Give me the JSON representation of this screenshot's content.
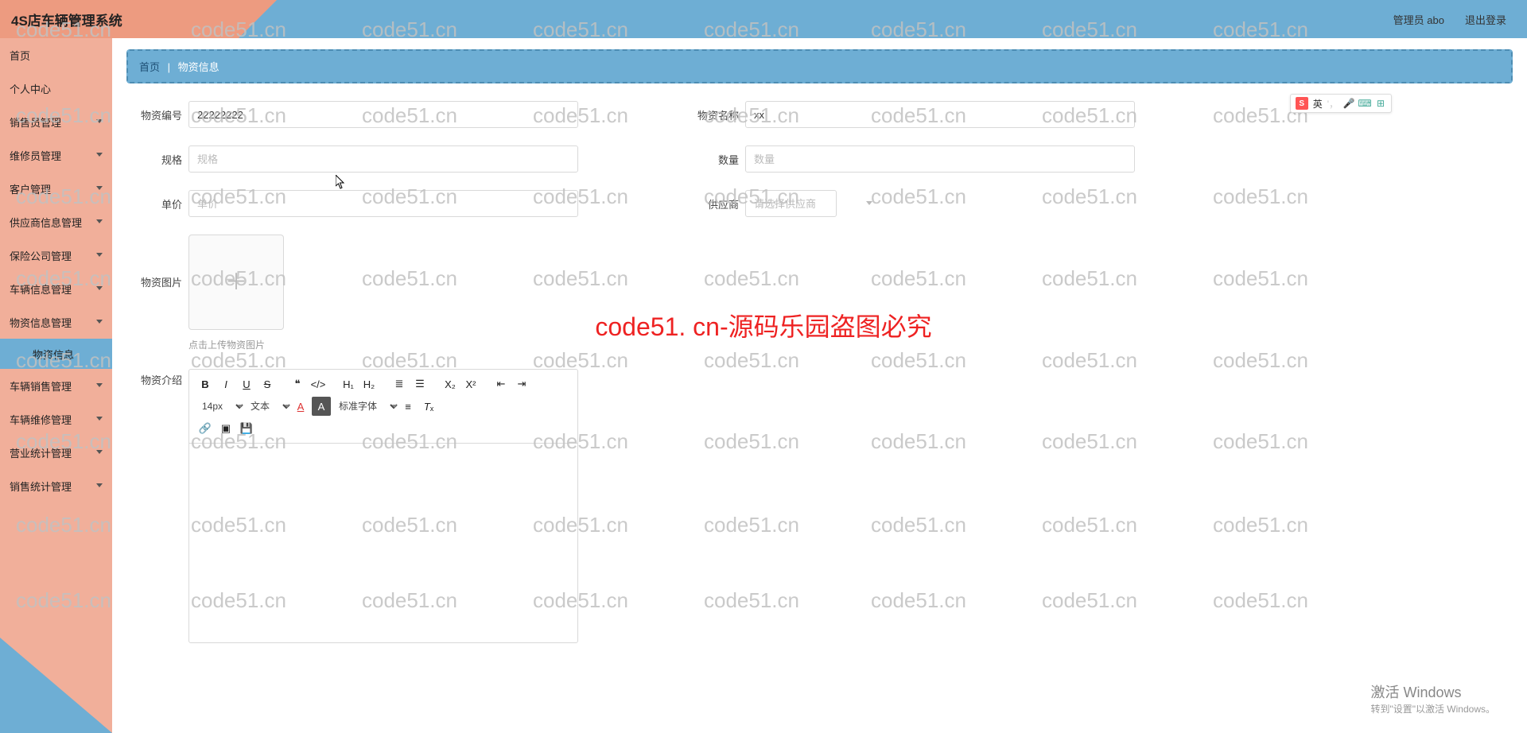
{
  "header": {
    "title": "4S店车辆管理系统",
    "user_label": "管理员 abo",
    "logout": "退出登录"
  },
  "sidebar": {
    "items": [
      {
        "label": "首页",
        "sub": false
      },
      {
        "label": "个人中心",
        "sub": false
      },
      {
        "label": "销售员管理",
        "sub": true
      },
      {
        "label": "维修员管理",
        "sub": true
      },
      {
        "label": "客户管理",
        "sub": true
      },
      {
        "label": "供应商信息管理",
        "sub": true
      },
      {
        "label": "保险公司管理",
        "sub": true
      },
      {
        "label": "车辆信息管理",
        "sub": true
      },
      {
        "label": "物资信息管理",
        "sub": true,
        "open": true,
        "child": "物资信息"
      },
      {
        "label": "车辆销售管理",
        "sub": true
      },
      {
        "label": "车辆维修管理",
        "sub": true
      },
      {
        "label": "营业统计管理",
        "sub": true
      },
      {
        "label": "销售统计管理",
        "sub": true
      }
    ]
  },
  "breadcrumb": {
    "home": "首页",
    "sep": "|",
    "current": "物资信息"
  },
  "form": {
    "code_label": "物资编号",
    "code_value": "22222222",
    "name_label": "物资名称",
    "name_value": "xx",
    "spec_label": "规格",
    "spec_placeholder": "规格",
    "qty_label": "数量",
    "qty_placeholder": "数量",
    "price_label": "单价",
    "price_placeholder": "单价",
    "vendor_label": "供应商",
    "vendor_placeholder": "请选择供应商",
    "img_label": "物资图片",
    "img_hint": "点击上传物资图片",
    "intro_label": "物资介绍"
  },
  "editor": {
    "fontsize": "14px",
    "para": "文本",
    "fontname": "标准字体"
  },
  "ime": {
    "lang": "英"
  },
  "watermark": {
    "text": "code51.cn",
    "big": "code51. cn-源码乐园盗图必究"
  },
  "windows": {
    "l1": "激活 Windows",
    "l2": "转到\"设置\"以激活 Windows。"
  }
}
